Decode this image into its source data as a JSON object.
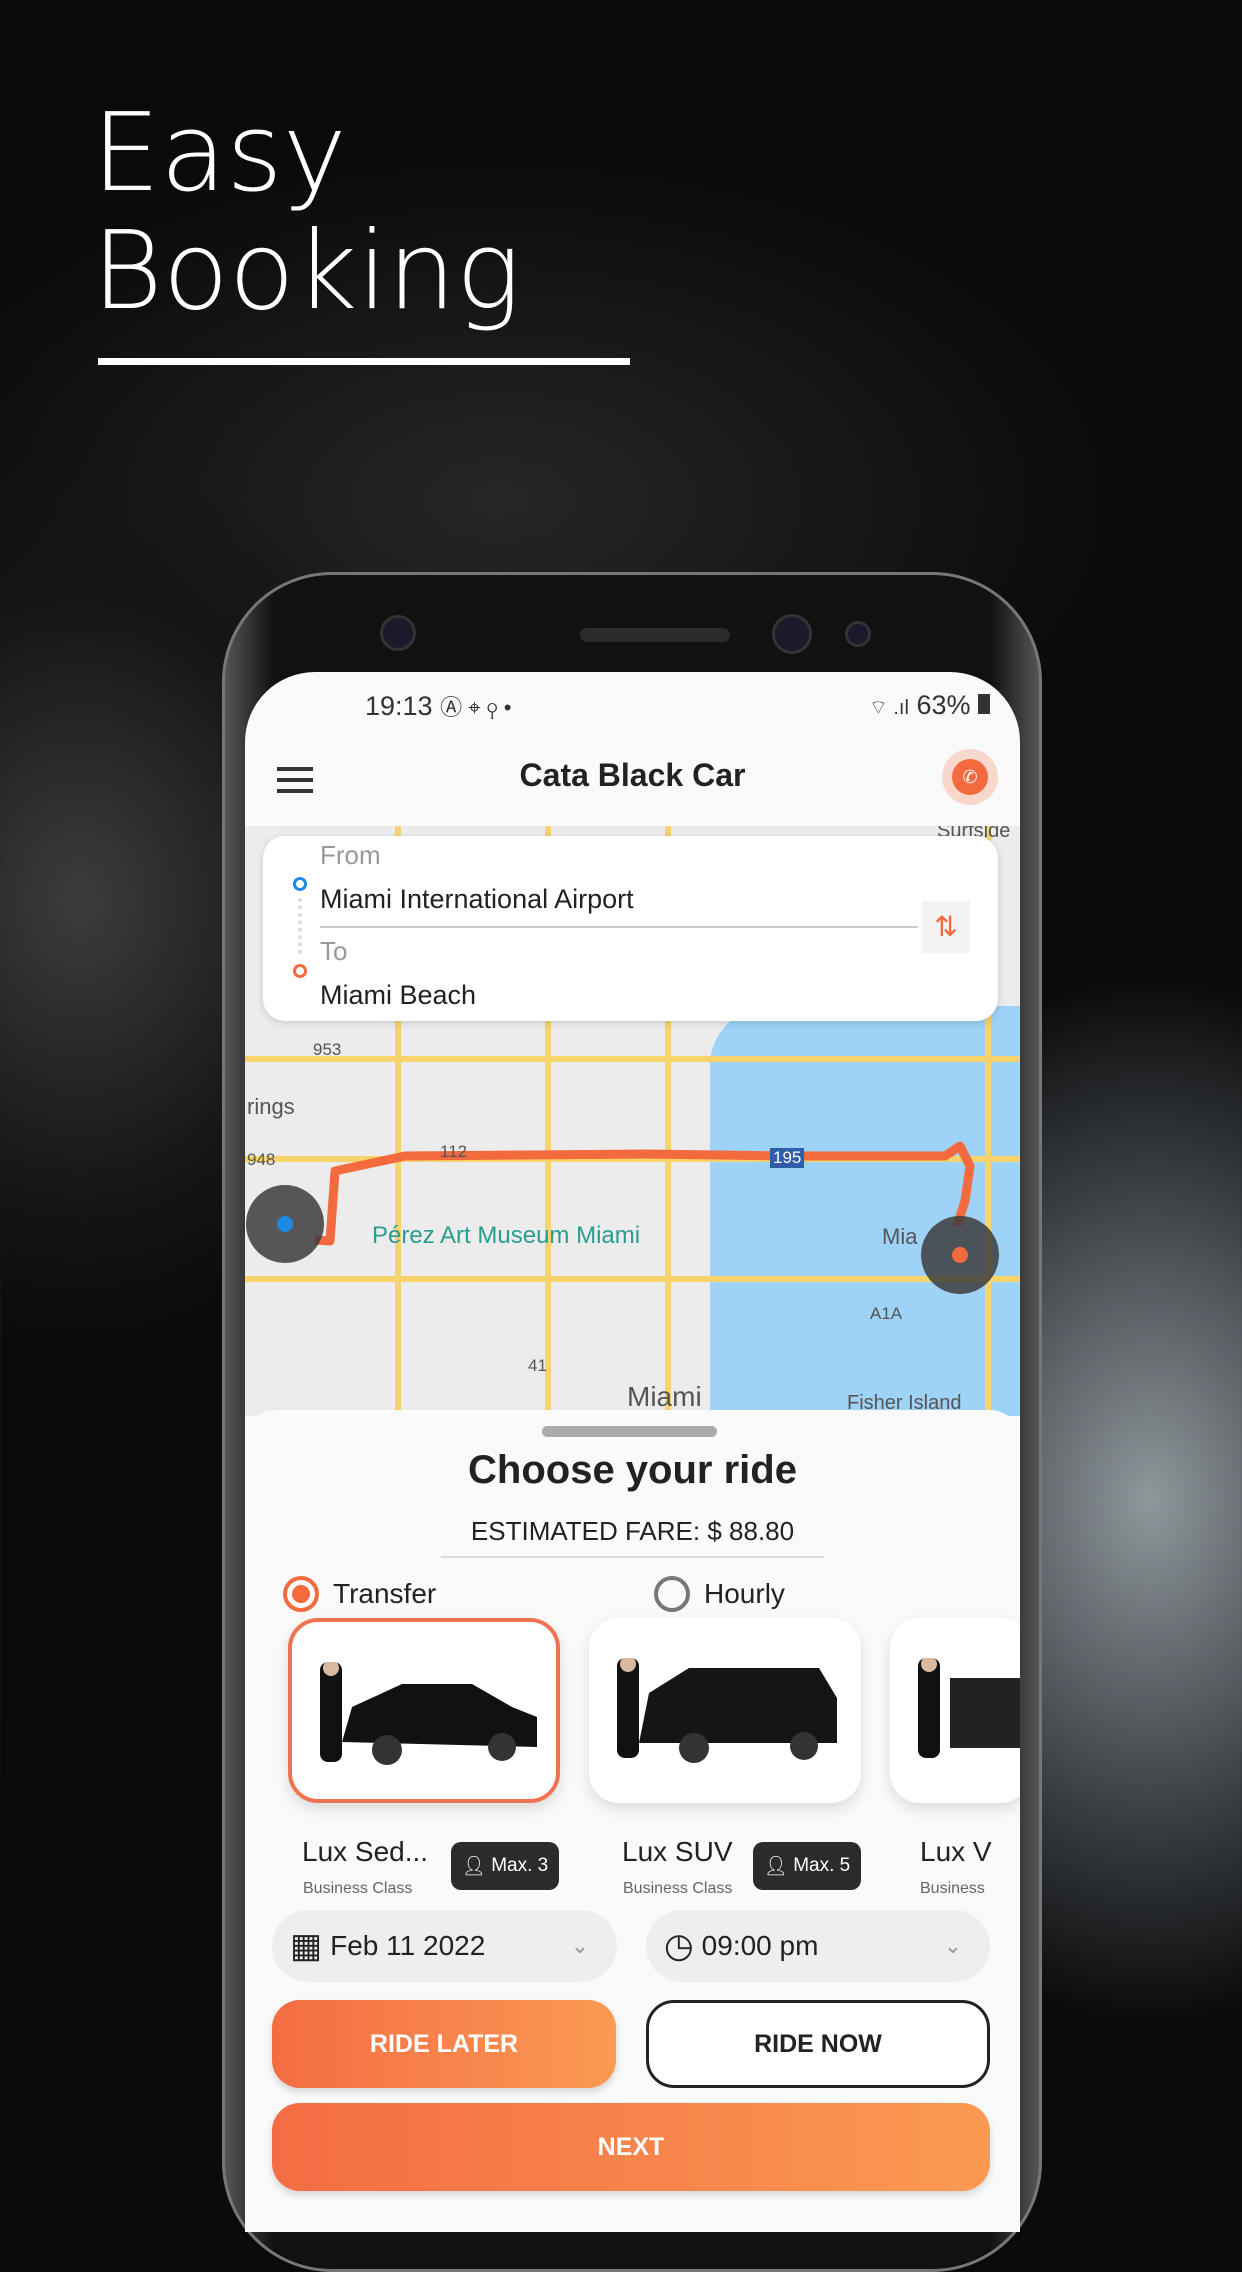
{
  "hero": {
    "line1": "Easy",
    "line2": "Booking"
  },
  "status": {
    "time": "19:13",
    "icons": "Ⓐ ⌖ ⚲ •",
    "signal": "⌔ .ıl",
    "battery": "63%"
  },
  "header": {
    "title": "Cata Black Car",
    "menu_icon": "hamburger-icon",
    "call_icon": "phone-icon"
  },
  "route": {
    "from_label": "From",
    "from_value": "Miami International Airport",
    "to_label": "To",
    "to_value": "Miami Beach",
    "swap_icon": "⇅"
  },
  "map": {
    "labels": [
      "Pérez Art Museum Miami",
      "Miami",
      "Fisher Island",
      "Surfside",
      "953",
      "112",
      "195",
      "41",
      "A1A",
      "948",
      "rings",
      "Mia"
    ]
  },
  "sheet": {
    "title": "Choose your ride",
    "fare": "ESTIMATED FARE: $ 88.80",
    "modes": [
      {
        "label": "Transfer",
        "selected": true
      },
      {
        "label": "Hourly",
        "selected": false
      }
    ],
    "cars": [
      {
        "name": "Lux Sed...",
        "class": "Business Class",
        "max": "Max. 3",
        "selected": true
      },
      {
        "name": "Lux SUV",
        "class": "Business Class",
        "max": "Max. 5",
        "selected": false
      },
      {
        "name": "Lux V",
        "class": "Business",
        "selected": false
      }
    ],
    "date": "Feb 11 2022",
    "time": "09:00 pm",
    "ride_later": "RIDE LATER",
    "ride_now": "RIDE NOW",
    "next": "NEXT"
  },
  "colors": {
    "accent": "#f26a3d",
    "route": "#f26a3d"
  }
}
